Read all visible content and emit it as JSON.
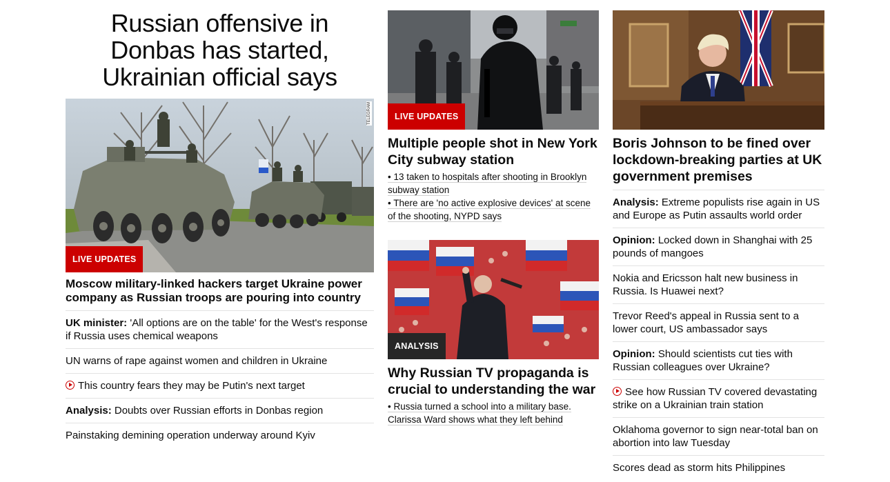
{
  "col1": {
    "lead_title": "Russian offensive in Donbas has started, Ukrainian official says",
    "image_badge": "LIVE UPDATES",
    "image_credit": "TELEGRAM",
    "headline": "Moscow military-linked hackers target Ukraine power company as Russian troops are pouring into country",
    "items": [
      {
        "prefix": "UK minister:",
        "text": " 'All options are on the table' for the West's response if Russia uses chemical weapons"
      },
      {
        "prefix": "",
        "text": "UN warns of rape against women and children in Ukraine"
      },
      {
        "prefix": "",
        "text": "This country fears they may be Putin's next target",
        "icon": "play-icon"
      },
      {
        "prefix": "Analysis:",
        "text": " Doubts over Russian efforts in Donbas region"
      },
      {
        "prefix": "",
        "text": "Painstaking demining operation underway around Kyiv"
      }
    ]
  },
  "col2": {
    "story1": {
      "badge": "LIVE UPDATES",
      "headline": "Multiple people shot in New York City subway station",
      "bullets": [
        "• 13 taken to hospitals after shooting in Brooklyn subway station",
        "• There are 'no active explosive devices' at scene of the shooting, NYPD says"
      ]
    },
    "story2": {
      "badge": "ANALYSIS",
      "headline": "Why Russian TV propaganda is crucial to understanding the war",
      "bullets": [
        "• Russia turned a school into a military base. Clarissa Ward shows what they left behind"
      ]
    }
  },
  "col3": {
    "headline": "Boris Johnson to be fined over lockdown-breaking parties at UK government premises",
    "items": [
      {
        "prefix": "Analysis:",
        "text": " Extreme populists rise again in US and Europe as Putin assaults world order"
      },
      {
        "prefix": "Opinion:",
        "text": " Locked down in Shanghai with 25 pounds of mangoes"
      },
      {
        "prefix": "",
        "text": "Nokia and Ericsson halt new business in Russia. Is Huawei next?"
      },
      {
        "prefix": "",
        "text": "Trevor Reed's appeal in Russia sent to a lower court, US ambassador says"
      },
      {
        "prefix": "Opinion:",
        "text": " Should scientists cut ties with Russian colleagues over Ukraine?"
      },
      {
        "prefix": "",
        "text": "See how Russian TV covered devastating strike on a Ukrainian train station",
        "icon": "play-icon"
      },
      {
        "prefix": "",
        "text": "Oklahoma governor to sign near-total ban on abortion into law Tuesday"
      },
      {
        "prefix": "",
        "text": "Scores dead as storm hits Philippines"
      }
    ]
  },
  "colors": {
    "brand_red": "#cc0000",
    "badge_dark": "#262626",
    "divider": "#e2e2e2"
  }
}
